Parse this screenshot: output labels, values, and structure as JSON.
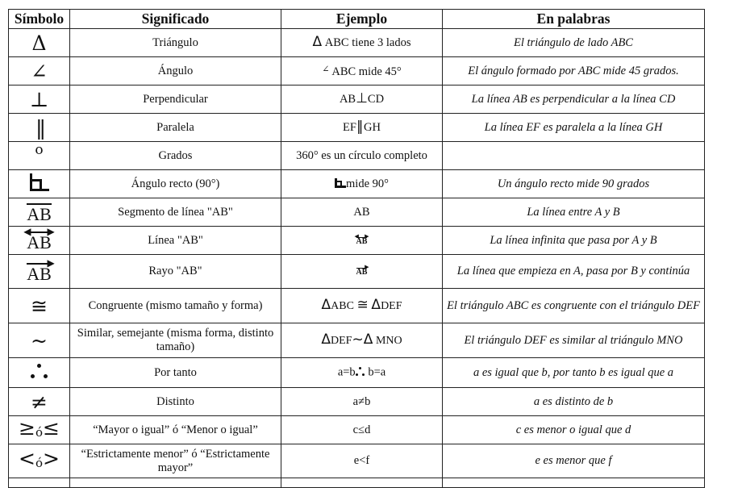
{
  "table": {
    "headers": [
      "Símbolo",
      "Significado",
      "Ejemplo",
      "En palabras"
    ],
    "rows": [
      {
        "symbol": "Δ",
        "meaning": "Triángulo",
        "ex_sym": "Δ",
        "ex_text": "ABC tiene 3 lados",
        "words": "El triángulo de lado ABC"
      },
      {
        "symbol": "∠",
        "meaning": "Ángulo",
        "ex_sym": "∠",
        "ex_text": "ABC mide 45°",
        "words": "El ángulo formado por ABC mide 45 grados."
      },
      {
        "symbol": "⊥",
        "meaning": "Perpendicular",
        "ex_a": "AB",
        "ex_sym": "⊥",
        "ex_b": "CD",
        "words": "La línea AB es perpendicular a la línea CD"
      },
      {
        "symbol": "||",
        "meaning": "Paralela",
        "ex_a": "EF",
        "ex_sym": "||",
        "ex_b": "GH",
        "words": "La línea EF es paralela a la línea GH"
      },
      {
        "symbol": "o",
        "meaning": "Grados",
        "ex_text": "360° es un círculo completo",
        "words": ""
      },
      {
        "symbol": "right-angle-icon",
        "meaning": "Ángulo recto (90°)",
        "ex_text": "mide 90°",
        "words": "Un ángulo recto mide 90 grados"
      },
      {
        "symbol": "AB",
        "meaning": "Segmento de línea \"AB\"",
        "ex_text": "AB",
        "words": "La línea entre A y B"
      },
      {
        "symbol": "AB",
        "meaning": "Línea \"AB\"",
        "ex_text": "AB",
        "words": "La línea infinita que pasa por A y B"
      },
      {
        "symbol": "AB",
        "meaning": "Rayo \"AB\"",
        "ex_text": "AB",
        "words": "La línea que empieza en A, pasa por B y continúa"
      },
      {
        "symbol": "≅",
        "meaning": "Congruente (mismo tamaño y forma)",
        "ex_a": "ABC",
        "ex_sym": "≅",
        "ex_b": "DEF",
        "words": "El triángulo ABC es congruente con el triángulo DEF"
      },
      {
        "symbol": "~",
        "meaning": "Similar, semejante (misma forma, distinto tamaño)",
        "ex_a": "DEF",
        "ex_sym": "~",
        "ex_b": "MNO",
        "words": "El triángulo DEF es similar al triángulo MNO"
      },
      {
        "symbol": "therefore-icon",
        "meaning": "Por tanto",
        "ex_a": "a=b",
        "ex_b": "b=a",
        "words": "a es igual que b, por tanto b es igual que a"
      },
      {
        "symbol": "≠",
        "meaning": "Distinto",
        "ex_text": "a≠b",
        "words": "a es distinto de b"
      },
      {
        "symbol_a": "≥",
        "symbol_o": "ó",
        "symbol_b": "≤",
        "meaning": "“Mayor o igual” ó “Menor o igual”",
        "ex_text": "c≤d",
        "words": "c es menor o igual que d"
      },
      {
        "symbol_a": "<",
        "symbol_o": "ó",
        "symbol_b": ">",
        "meaning": "“Estrictamente menor” ó “Estrictamente mayor”",
        "ex_text": "e<f",
        "words": "e es menor que f"
      }
    ]
  }
}
